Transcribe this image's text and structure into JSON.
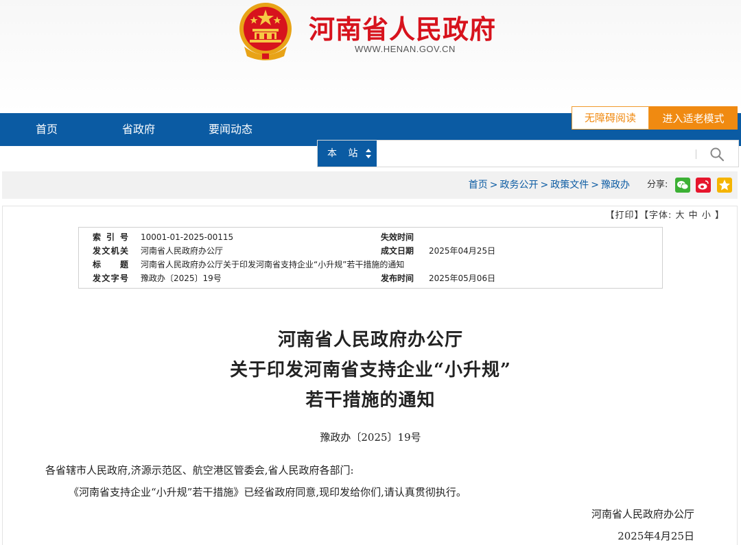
{
  "header": {
    "site_title": "河南省人民政府",
    "site_url": "WWW.HENAN.GOV.CN"
  },
  "nav": {
    "items": [
      "首页",
      "省政府",
      "要闻动态"
    ]
  },
  "accessibility": {
    "barrier_free": "无障碍阅读",
    "elder_mode": "进入适老模式"
  },
  "search": {
    "scope": "本 站",
    "placeholder": ""
  },
  "breadcrumb": {
    "items": [
      "首页",
      "政务公开",
      "政策文件",
      "豫政办"
    ],
    "separator": ">",
    "share_label": "分享:"
  },
  "tools": {
    "print": "【打印】",
    "font_size": "【字体:",
    "large": "大",
    "medium": "中",
    "small": "小",
    "close": "】"
  },
  "meta": {
    "index_label": "索 引 号",
    "index_value": "10001-01-2025-00115",
    "expiry_label": "失效时间",
    "expiry_value": "",
    "issuer_label": "发文机关",
    "issuer_value": "河南省人民政府办公厅",
    "created_label": "成文日期",
    "created_value": "2025年04月25日",
    "title_label": "标 题",
    "title_value": "河南省人民政府办公厅关于印发河南省支持企业“小升规”若干措施的通知",
    "docno_label": "发文字号",
    "docno_value": "豫政办〔2025〕19号",
    "publish_label": "发布时间",
    "publish_value": "2025年05月06日"
  },
  "document": {
    "title_line1": "河南省人民政府办公厅",
    "title_line2": "关于印发河南省支持企业“小升规”",
    "title_line3": "若干措施的通知",
    "number": "豫政办〔2025〕19号",
    "recipients": "各省辖市人民政府,济源示范区、航空港区管委会,省人民政府各部门:",
    "body": "《河南省支持企业“小升规”若干措施》已经省政府同意,现印发给你们,请认真贯彻执行。",
    "sign_org": "河南省人民政府办公厅",
    "sign_date": "2025年4月25日"
  },
  "colors": {
    "brand_red": "#d7131d",
    "nav_blue": "#0b5ba3",
    "accent_orange": "#f08a11"
  }
}
